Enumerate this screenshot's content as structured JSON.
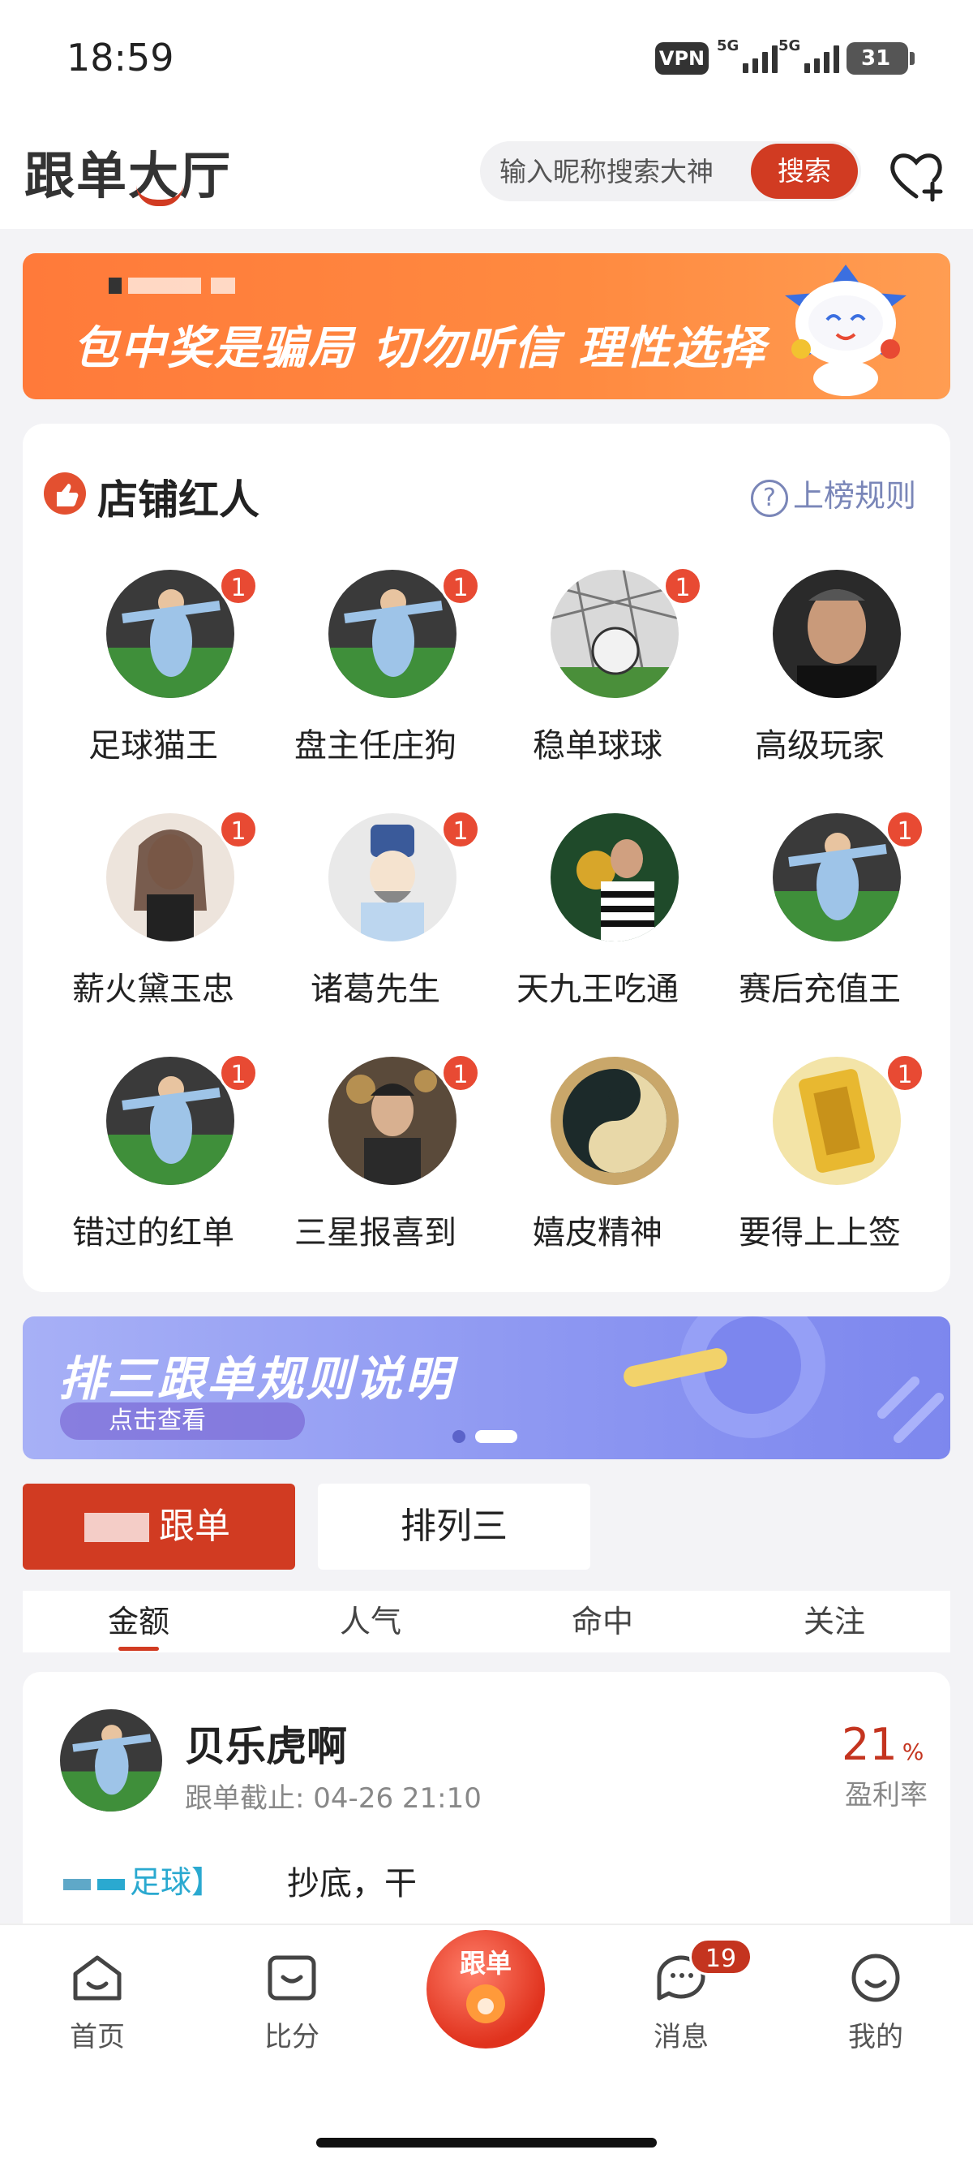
{
  "status_bar": {
    "time": "18:59",
    "vpn": "VPN",
    "net1": "5G",
    "net2": "5G",
    "battery": "31"
  },
  "header": {
    "logo": "跟单大厅",
    "search_placeholder": "输入昵称搜索大神",
    "search_button": "搜索"
  },
  "banner": {
    "text": "包中奖是骗局 切勿听信 理性选择"
  },
  "section": {
    "title": "店铺红人",
    "rules_label": "上榜规则",
    "influencers": [
      {
        "name": "足球猫王",
        "badge": "1",
        "avatar": "player"
      },
      {
        "name": "盘主任庄狗",
        "badge": "1",
        "avatar": "player"
      },
      {
        "name": "稳单球球",
        "badge": "1",
        "avatar": "ball"
      },
      {
        "name": "高级玩家",
        "badge": "",
        "avatar": "man"
      },
      {
        "name": "薪火黛玉忠",
        "badge": "1",
        "avatar": "woman"
      },
      {
        "name": "诸葛先生",
        "badge": "1",
        "avatar": "cartoon"
      },
      {
        "name": "天九王吃通",
        "badge": "",
        "avatar": "trophy"
      },
      {
        "name": "赛后充值王",
        "badge": "1",
        "avatar": "player"
      },
      {
        "name": "错过的红单",
        "badge": "1",
        "avatar": "player"
      },
      {
        "name": "三星报喜到",
        "badge": "1",
        "avatar": "boy"
      },
      {
        "name": "嬉皮精神",
        "badge": "",
        "avatar": "yinyang"
      },
      {
        "name": "要得上上签",
        "badge": "1",
        "avatar": "gold"
      }
    ]
  },
  "rules_banner": {
    "title": "排三跟单规则说明",
    "subtitle": "点击查看"
  },
  "tabs": {
    "active": "跟单",
    "inactive": "排列三"
  },
  "subtabs": [
    "金额",
    "人气",
    "命中",
    "关注"
  ],
  "post": {
    "name": "贝乐虎啊",
    "deadline_label": "跟单截止:",
    "deadline_value": "04-26 21:10",
    "rate": "21",
    "rate_unit": "%",
    "rate_label": "盈利率",
    "tag": "足球】",
    "text": "抄底，干"
  },
  "bottom_nav": {
    "home": "首页",
    "scores": "比分",
    "center": "跟单",
    "messages": "消息",
    "messages_badge": "19",
    "mine": "我的"
  },
  "colors": {
    "brand": "#d13b22",
    "banner_orange": "#ff7a3a",
    "rules_purple": "#8e98f2"
  }
}
